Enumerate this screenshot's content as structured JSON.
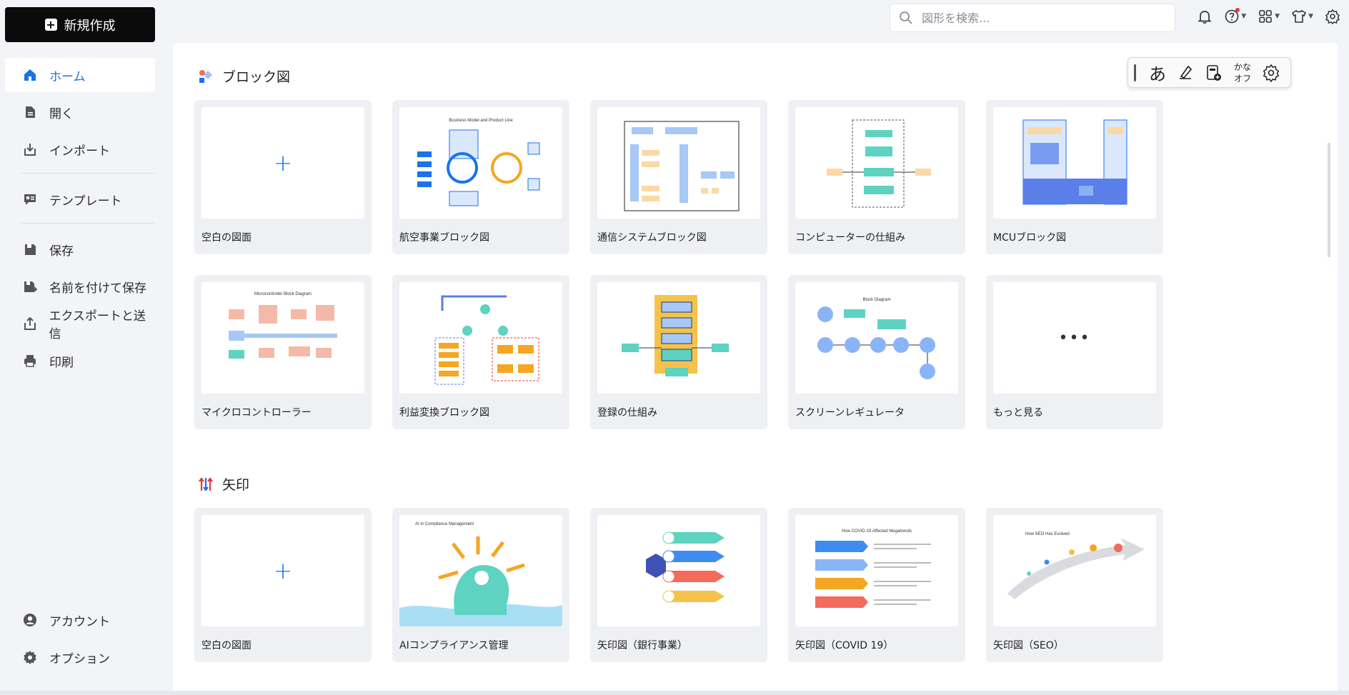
{
  "sidebar": {
    "new_button": "新規作成",
    "items": [
      {
        "label": "ホーム",
        "icon": "home-icon",
        "active": true
      },
      {
        "label": "開く",
        "icon": "open-file-icon"
      },
      {
        "label": "インポート",
        "icon": "import-icon"
      },
      {
        "label": "テンプレート",
        "icon": "template-icon"
      },
      {
        "label": "保存",
        "icon": "save-icon"
      },
      {
        "label": "名前を付けて保存",
        "icon": "save-as-icon"
      },
      {
        "label": "エクスポートと送信",
        "icon": "export-icon"
      },
      {
        "label": "印刷",
        "icon": "print-icon"
      }
    ],
    "bottom_items": [
      {
        "label": "アカウント",
        "icon": "account-icon"
      },
      {
        "label": "オプション",
        "icon": "gear-icon"
      }
    ]
  },
  "search": {
    "placeholder": "図形を検索..."
  },
  "ime": {
    "kana": "あ",
    "kana_off_line1": "かな",
    "kana_off_line2": "オフ"
  },
  "sections": [
    {
      "title": "ブロック図",
      "cards": [
        {
          "label": "空白の図面",
          "kind": "blank"
        },
        {
          "label": "航空事業ブロック図",
          "kind": "diagram"
        },
        {
          "label": "通信システムブロック図",
          "kind": "diagram"
        },
        {
          "label": "コンピューターの仕組み",
          "kind": "diagram"
        },
        {
          "label": "MCUブロック図",
          "kind": "diagram"
        },
        {
          "label": "マイクロコントローラー",
          "kind": "diagram"
        },
        {
          "label": "利益変換ブロック図",
          "kind": "diagram"
        },
        {
          "label": "登録の仕組み",
          "kind": "diagram"
        },
        {
          "label": "スクリーンレギュレータ",
          "kind": "diagram"
        },
        {
          "label": "もっと見る",
          "kind": "more"
        }
      ]
    },
    {
      "title": "矢印",
      "cards": [
        {
          "label": "空白の図面",
          "kind": "blank"
        },
        {
          "label": "AIコンプライアンス管理",
          "kind": "diagram"
        },
        {
          "label": "矢印図（銀行事業）",
          "kind": "diagram"
        },
        {
          "label": "矢印図（COVID 19）",
          "kind": "diagram"
        },
        {
          "label": "矢印図（SEO）",
          "kind": "diagram"
        }
      ]
    }
  ],
  "thumb_texts": {
    "aviation": "Business Model and Product Line",
    "micro": "Microcontroller Block Diagram",
    "screen": "Block Diagram",
    "ai": "AI in Compliance Management",
    "covid": "How COVID-19 Affected Megatrends",
    "seo": "How SEO Has Evolved"
  },
  "colors": {
    "accent": "#1a73e8",
    "new_button_bg": "#0b0b0b"
  }
}
